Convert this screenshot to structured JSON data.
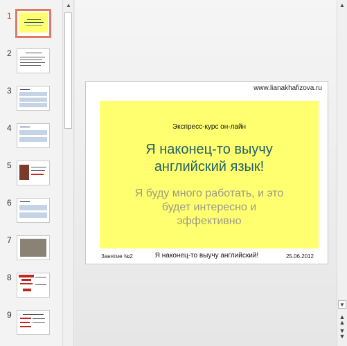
{
  "thumbnails": [
    {
      "num": "1"
    },
    {
      "num": "2"
    },
    {
      "num": "3"
    },
    {
      "num": "4"
    },
    {
      "num": "5"
    },
    {
      "num": "6"
    },
    {
      "num": "7"
    },
    {
      "num": "8"
    },
    {
      "num": "9"
    }
  ],
  "slide": {
    "site": "www.lianakhafizova.ru",
    "subtitle": "Экспресс-курс он-лайн",
    "title_line1": "Я наконец-то выучу",
    "title_line2": "английский язык!",
    "body_line1": "Я буду много работать, и это",
    "body_line2": "будет интересно и",
    "body_line3": "эффективно",
    "footer_left": "Занятие №2",
    "footer_center": "Я наконец-то выучу английский!",
    "footer_right": "25.06.2012"
  },
  "colors": {
    "accent": "#d24726",
    "slide_bg": "#ffff70",
    "title": "#1f6167"
  }
}
